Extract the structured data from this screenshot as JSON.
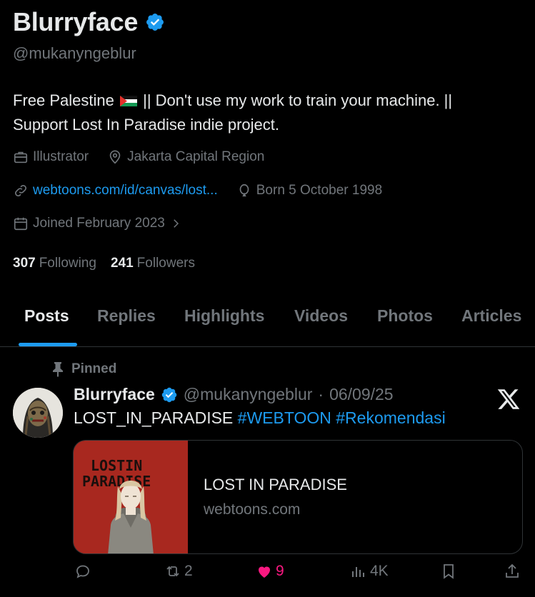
{
  "profile": {
    "display_name": "Blurryface",
    "handle": "@mukanyngeblur",
    "bio_line1_before_flag": "Free Palestine",
    "bio_line1_after_flag": "|| Don't use my work to train your machine. ||",
    "bio_line2": "Support Lost In Paradise indie project.",
    "profession": "Illustrator",
    "location": "Jakarta Capital Region",
    "website": "webtoons.com/id/canvas/lost...",
    "birthday": "Born 5 October 1998",
    "joined": "Joined February 2023",
    "following_count": "307",
    "following_label": "Following",
    "followers_count": "241",
    "followers_label": "Followers"
  },
  "tabs": [
    "Posts",
    "Replies",
    "Highlights",
    "Videos",
    "Photos",
    "Articles"
  ],
  "post": {
    "pinned_label": "Pinned",
    "author_name": "Blurryface",
    "author_handle": "@mukanyngeblur",
    "separator": "·",
    "date": "06/09/25",
    "text": "LOST_IN_PARADISE",
    "hashtag1": "#WEBTOON",
    "hashtag2": "#Rekomendasi",
    "card": {
      "title": "LOST IN PARADISE",
      "domain": "webtoons.com",
      "thumb_text_line1": "LOSTIN",
      "thumb_text_line2": "PARADISE"
    },
    "retweets": "2",
    "likes": "9",
    "views": "4K"
  },
  "colors": {
    "background": "#000000",
    "text": "#e7e9ea",
    "muted": "#71767b",
    "accent": "#1d9bf0",
    "like": "#f91880"
  }
}
